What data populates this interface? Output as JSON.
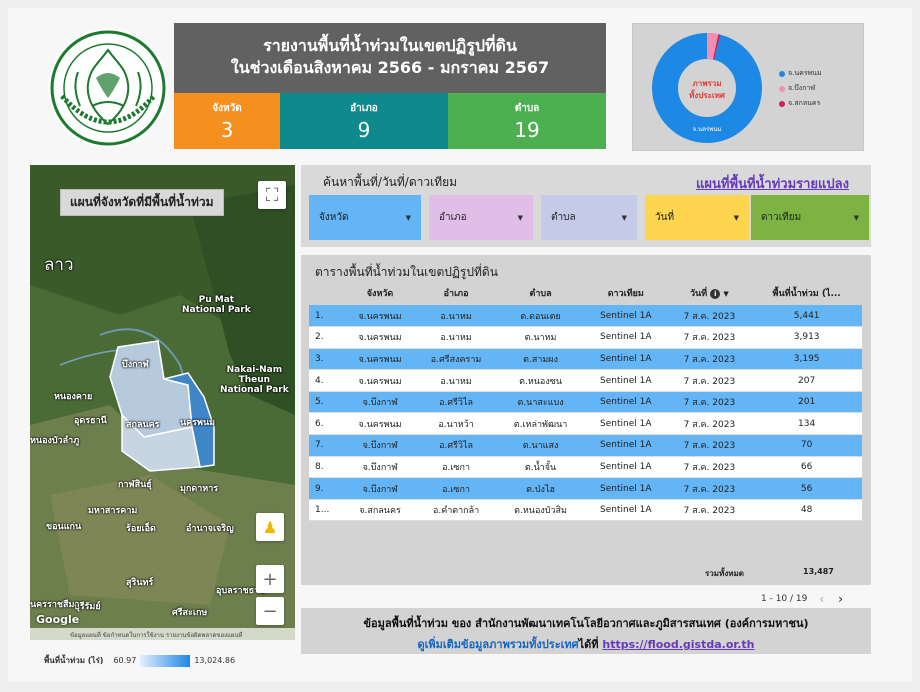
{
  "header": {
    "title_line1": "รายงานพื้นที่น้ำท่วมในเขตปฏิรูปที่ดิน",
    "title_line2": "ในช่วงเดือนสิงหาคม 2566 - มกราคม 2567",
    "logo_text": "สำนักงานการปฏิรูปที่ดินเพื่อเกษตรกรรม"
  },
  "stats": {
    "province_label": "จังหวัด",
    "province_value": "3",
    "district_label": "อำเภอ",
    "district_value": "9",
    "subdistrict_label": "ตำบล",
    "subdistrict_value": "19"
  },
  "donut": {
    "center_line1": "ภาพรวม",
    "center_line2": "ทั้งประเทศ",
    "slice_label": "จ.นครพนม",
    "legend": [
      {
        "label": "จ.นครพนม",
        "color": "#1e88e5"
      },
      {
        "label": "จ.บึงกาฬ",
        "color": "#f48fb1"
      },
      {
        "label": "จ.สกลนคร",
        "color": "#d81b60"
      }
    ]
  },
  "map": {
    "title": "แผนที่จังหวัดที่มีพื้นที่น้ำท่วม",
    "labels": {
      "laos": "ลาว",
      "pumat": "Pu Mat\nNational Park",
      "bueng_kan": "บึงกาฬ",
      "nong_khai": "หนองคาย",
      "udon": "อุดรธานี",
      "sakon": "สกลนคร",
      "nakhon_phanom": "นครพนม",
      "nong_bua": "หนองบัวลำภู",
      "nakai": "Nakai-Nam\nTheun\nNational Park",
      "kalasin": "กาฬสินธุ์",
      "mukdahan": "มุกดาหาร",
      "maha": "มหาสารคาม",
      "khon": "ขอนแก่น",
      "roiet": "ร้อยเอ็ด",
      "amnat": "อำนาจเจริญ",
      "surin": "สุรินทร์",
      "ubon": "อุบลราชธานี",
      "buriram": "บุรีรัมย์",
      "nakhonratch": "นครราชสีมา",
      "sisaket": "ศรีสะเกษ"
    },
    "footer": "ข้อมูลแผนที่   ข้อกำหนดในการใช้งาน   รายงานข้อผิดพลาดของแผนที่",
    "google": "Google",
    "legend_label": "พื้นที่น้ำท่วม (ไร่)",
    "legend_min": "60.97",
    "legend_max": "13,024.86"
  },
  "search": {
    "title": "ค้นหาพื้นที่/วันที่/ดาวเทียม",
    "link": "แผนที่พื้นที่น้ำท่วมรายแปลง",
    "filters": [
      {
        "label": "จังหวัด",
        "color": "#64b5f6"
      },
      {
        "label": "อำเภอ",
        "color": "#e1bee7"
      },
      {
        "label": "ตำบล",
        "color": "#c5cae9"
      },
      {
        "label": "วันที่",
        "color": "#ffd54f"
      },
      {
        "label": "ดาวเทียม",
        "color": "#7cb342"
      }
    ]
  },
  "table": {
    "title": "ตารางพื้นที่น้ำท่วมในเขตปฏิรูปที่ดิน",
    "columns": [
      "",
      "จังหวัด",
      "อำเภอ",
      "ตำบล",
      "ดาวเทียม",
      "วันที่",
      "พื้นที่น้ำท่วม (ไ..."
    ],
    "rows": [
      [
        "1.",
        "จ.นครพนม",
        "อ.นาหม",
        "ต.ดอนเตย",
        "Sentinel 1A",
        "7 ส.ค. 2023",
        "5,441"
      ],
      [
        "2.",
        "จ.นครพนม",
        "อ.นาหม",
        "ต.นาหม",
        "Sentinel 1A",
        "7 ส.ค. 2023",
        "3,913"
      ],
      [
        "3.",
        "จ.นครพนม",
        "อ.ศรีสงคราม",
        "ต.สามผง",
        "Sentinel 1A",
        "7 ส.ค. 2023",
        "3,195"
      ],
      [
        "4.",
        "จ.นครพนม",
        "อ.นาหม",
        "ต.หนองซน",
        "Sentinel 1A",
        "7 ส.ค. 2023",
        "207"
      ],
      [
        "5.",
        "จ.บึงกาฬ",
        "อ.ศรีวิไล",
        "ต.นาสะแบง",
        "Sentinel 1A",
        "7 ส.ค. 2023",
        "201"
      ],
      [
        "6.",
        "จ.นครพนม",
        "อ.นาหว้า",
        "ต.เหล่าพัฒนา",
        "Sentinel 1A",
        "7 ส.ค. 2023",
        "134"
      ],
      [
        "7.",
        "จ.บึงกาฬ",
        "อ.ศรีวิไล",
        "ต.นาแสง",
        "Sentinel 1A",
        "7 ส.ค. 2023",
        "70"
      ],
      [
        "8.",
        "จ.บึงกาฬ",
        "อ.เซกา",
        "ต.น้ำจั้น",
        "Sentinel 1A",
        "7 ส.ค. 2023",
        "66"
      ],
      [
        "9.",
        "จ.บึงกาฬ",
        "อ.เซกา",
        "ต.ป่งไฮ",
        "Sentinel 1A",
        "7 ส.ค. 2023",
        "56"
      ],
      [
        "1...",
        "จ.สกลนคร",
        "อ.คำตากล้า",
        "ต.หนองบัวสิม",
        "Sentinel 1A",
        "7 ส.ค. 2023",
        "48"
      ]
    ],
    "total_label": "รวมทั้งหมด",
    "total_value": "13,487",
    "pager": "1 - 10 / 19"
  },
  "footer": {
    "line1": "ข้อมูลพื้นที่น้ำท่วม ของ สำนักงานพัฒนาเทคโนโลยีอวกาศและภูมิสารสนเทศ (องค์การมหาชน)",
    "line2_a": "ดูเพิ่มเติมข้อมูลภาพรวมทั้งประเทศ",
    "line2_b": "ได้ที่",
    "url": "https://flood.gistda.or.th"
  }
}
